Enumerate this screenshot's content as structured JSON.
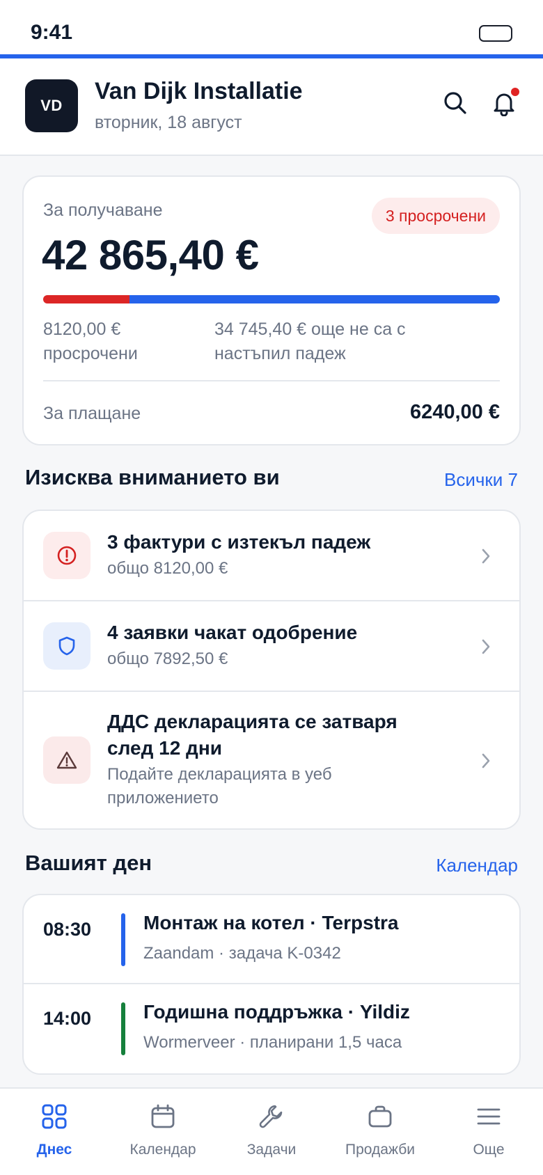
{
  "status_bar": {
    "time": "9:41"
  },
  "theme": {
    "accent": "#2563eb",
    "danger": "#dc2626",
    "success": "#16803c"
  },
  "header": {
    "avatar_initials": "VD",
    "company": "Van Dijk Installatie",
    "date": "вторник, 18 август",
    "icons": [
      "search-icon",
      "bell-icon"
    ]
  },
  "receivables": {
    "label": "За получаване",
    "amount": "42 865,40 €",
    "overdue_badge": "3 просрочени",
    "overdue_fraction": 0.189,
    "overdue_text": "8120,00 € просрочени",
    "not_due_text": "34 745,40 € още не са с настъпил падеж",
    "payable_label": "За плащане",
    "payable_amount": "6240,00 €"
  },
  "attention": {
    "title": "Изисква вниманието ви",
    "link": "Всички 7",
    "items": [
      {
        "icon": "alert-circle-icon",
        "title": "3 фактури с изтекъл падеж",
        "subtitle": "общо 8120,00 €"
      },
      {
        "icon": "shield-icon",
        "title": "4 заявки чакат одобрение",
        "subtitle": "общо 7892,50 €"
      },
      {
        "icon": "warning-triangle-icon",
        "title": "ДДС декларацията се затваря след 12 дни",
        "subtitle": "Подайте декларацията в уеб приложението"
      }
    ]
  },
  "day": {
    "title": "Вашият ден",
    "link": "Календар",
    "events": [
      {
        "time": "08:30",
        "title": "Монтаж на котел · Terpstra",
        "subtitle": "Zaandam · задача K-0342",
        "color": "#2563eb"
      },
      {
        "time": "14:00",
        "title": "Годишна поддръжка · Yildiz",
        "subtitle": "Wormerveer · планирани 1,5 часа",
        "color": "#16803c"
      }
    ]
  },
  "nav": [
    {
      "label": "Днес",
      "icon": "grid-icon",
      "active": true
    },
    {
      "label": "Календар",
      "icon": "calendar-icon",
      "active": false
    },
    {
      "label": "Задачи",
      "icon": "wrench-icon",
      "active": false
    },
    {
      "label": "Продажби",
      "icon": "briefcase-icon",
      "active": false
    },
    {
      "label": "Още",
      "icon": "menu-icon",
      "active": false
    }
  ]
}
